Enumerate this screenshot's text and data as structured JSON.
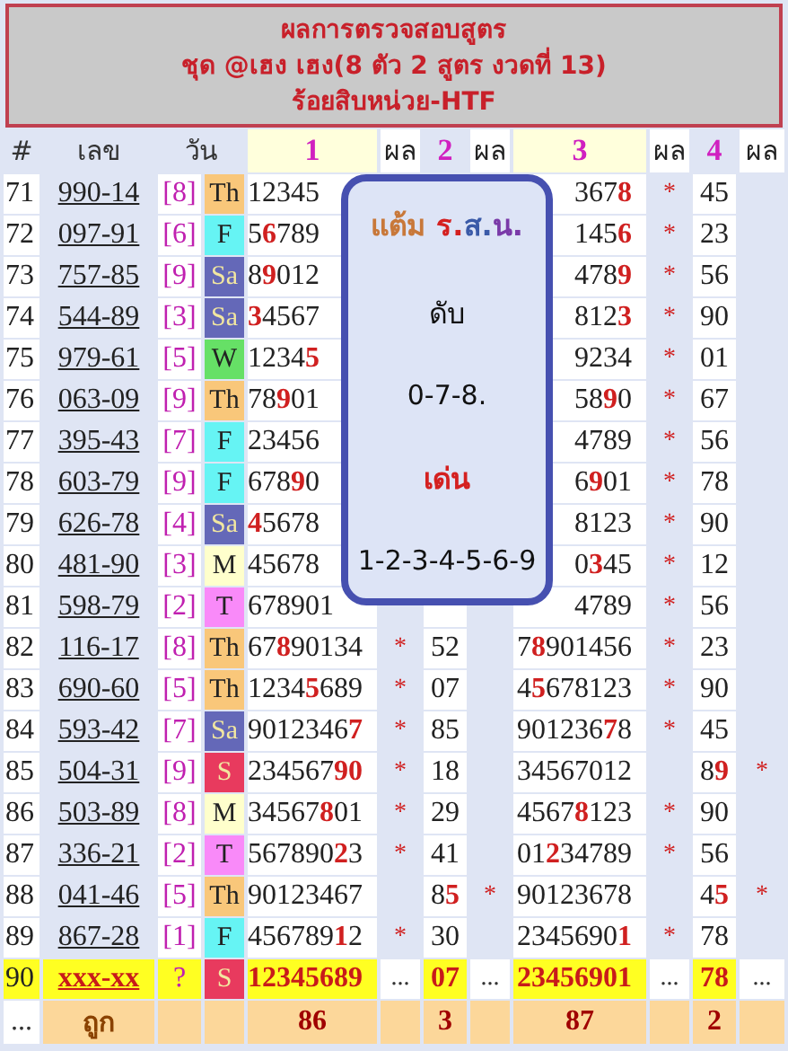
{
  "title": {
    "lines": [
      "ผลการตรวจสอบสูตร",
      "ชุด @เฮง เฮง(8 ตัว 2 สูตร งวดที่ 13)",
      "ร้อยสิบหน่วย-HTF"
    ]
  },
  "header": [
    "#",
    "เลข",
    "วัน",
    "1",
    "ผล",
    "2",
    "ผล",
    "3",
    "ผล",
    "4",
    "ผล"
  ],
  "rows": [
    {
      "no": "71",
      "code": "990-14",
      "digit": "[8]",
      "day": "Th",
      "color": "#f9c77a",
      "highlighted": false,
      "r1": "12345",
      "r3": "367**8**",
      "m3": "*",
      "r4": "45"
    },
    {
      "no": "72",
      "code": "097-91",
      "digit": "[6]",
      "day": "F",
      "color": "#66f4f4",
      "highlighted": false,
      "r1": "5**6**789",
      "r3": "145**6**",
      "m3": "*",
      "r4": "23"
    },
    {
      "no": "73",
      "code": "757-85",
      "digit": "[9]",
      "day": "Sa",
      "color": "#6468b8",
      "highlighted": false,
      "r1": "8**9**012",
      "r3": "478**9**",
      "m3": "*",
      "r4": "56"
    },
    {
      "no": "74",
      "code": "544-89",
      "digit": "[3]",
      "day": "Sa",
      "color": "#6468b8",
      "highlighted": false,
      "r1": "**3**4567",
      "r3": "812**3**",
      "m3": "*",
      "r4": "90"
    },
    {
      "no": "75",
      "code": "979-61",
      "digit": "[5]",
      "day": "W",
      "color": "#66e066",
      "highlighted": false,
      "r1": "1234**5**",
      "r3": "9234",
      "m3": "*",
      "r4": "01"
    },
    {
      "no": "76",
      "code": "063-09",
      "digit": "[9]",
      "day": "Th",
      "color": "#f9c77a",
      "highlighted": false,
      "r1": "78**9**01",
      "r3": "58**9**0",
      "m3": "*",
      "r4": "67"
    },
    {
      "no": "77",
      "code": "395-43",
      "digit": "[7]",
      "day": "F",
      "color": "#66f4f4",
      "highlighted": false,
      "r1": "23456",
      "r3": "4789",
      "m3": "*",
      "r4": "56"
    },
    {
      "no": "78",
      "code": "603-79",
      "digit": "[9]",
      "day": "F",
      "color": "#66f4f4",
      "highlighted": false,
      "r1": "678**9**0",
      "r3": "6**9**01",
      "m3": "*",
      "r4": "78"
    },
    {
      "no": "79",
      "code": "626-78",
      "digit": "[4]",
      "day": "Sa",
      "color": "#6468b8",
      "highlighted": false,
      "r1": "**4**5678",
      "r3": "8123",
      "m3": "*",
      "r4": "90"
    },
    {
      "no": "80",
      "code": "481-90",
      "digit": "[3]",
      "day": "M",
      "color": "#ffffcc",
      "highlighted": false,
      "r1": "45678",
      "r3": "0**3**45",
      "m3": "*",
      "r4": "12"
    },
    {
      "no": "81",
      "code": "598-79",
      "digit": "[2]",
      "day": "T",
      "color": "#f98af9",
      "highlighted": false,
      "r1": "678901",
      "r3": "4789",
      "m3": "*",
      "r4": "56"
    },
    {
      "no": "82",
      "code": "116-17",
      "digit": "[8]",
      "day": "Th",
      "color": "#f9c77a",
      "highlighted": false,
      "r1": "67**8**90134",
      "m1": "*",
      "r2": "52",
      "r3": "7**8**901456",
      "m3": "*",
      "r4": "23"
    },
    {
      "no": "83",
      "code": "690-60",
      "digit": "[5]",
      "day": "Th",
      "color": "#f9c77a",
      "highlighted": false,
      "r1": "1234**5**689",
      "m1": "*",
      "r2": "07",
      "r3": "4**5**678123",
      "m3": "*",
      "r4": "90"
    },
    {
      "no": "84",
      "code": "593-42",
      "digit": "[7]",
      "day": "Sa",
      "color": "#6468b8",
      "highlighted": false,
      "r1": "9012346**7**",
      "m1": "*",
      "r2": "85",
      "r3": "901236**7**8",
      "m3": "*",
      "r4": "45"
    },
    {
      "no": "85",
      "code": "504-31",
      "digit": "[9]",
      "day": "S",
      "color": "#e83a5e",
      "highlighted": false,
      "r1": "234567**90**",
      "m1": "*",
      "r2": "18",
      "r3": "34567012",
      "r4": "8**9**",
      "m4": "*"
    },
    {
      "no": "86",
      "code": "503-89",
      "digit": "[8]",
      "day": "M",
      "color": "#ffffcc",
      "highlighted": false,
      "r1": "34567**8**01",
      "m1": "*",
      "r2": "29",
      "r3": "4567**8**123",
      "m3": "*",
      "r4": "90"
    },
    {
      "no": "87",
      "code": "336-21",
      "digit": "[2]",
      "day": "T",
      "color": "#f98af9",
      "highlighted": false,
      "r1": "567890**2**3",
      "m1": "*",
      "r2": "41",
      "r3": "01**2**34789",
      "m3": "*",
      "r4": "56"
    },
    {
      "no": "88",
      "code": "041-46",
      "digit": "[5]",
      "day": "Th",
      "color": "#f9c77a",
      "highlighted": false,
      "r1": "90123467",
      "r2": "8**5**",
      "m2": "*",
      "r3": "90123678",
      "r4": "4**5**",
      "m4": "*"
    },
    {
      "no": "89",
      "code": "867-28",
      "digit": "[1]",
      "day": "F",
      "color": "#66f4f4",
      "highlighted": false,
      "r1": "456789**1**2",
      "m1": "*",
      "r2": "30",
      "r3": "2345690**1**",
      "m3": "*",
      "r4": "78"
    },
    {
      "no": "90",
      "code": "xxx-xx",
      "digit": "?",
      "day": "S",
      "color": "#e83a5e",
      "highlighted": true,
      "r1": "12345689",
      "m1": "...",
      "r2": "07",
      "m2": "...",
      "r3": "23456901",
      "m3": "...",
      "r4": "78",
      "m4": "..."
    }
  ],
  "footer": {
    "mark": "...",
    "label": "ถูก",
    "totals": [
      "86",
      "3",
      "87",
      "2"
    ]
  },
  "box": {
    "lines": [
      {
        "kind": "heading",
        "parts": [
          {
            "text": "แต้ม",
            "color": "#c8783a"
          },
          {
            "text": " ร.",
            "color": "#d42020"
          },
          {
            "text": "ส.",
            "color": "#3a5aa8"
          },
          {
            "text": "น.",
            "color": "#7a3aa8"
          }
        ]
      },
      {
        "kind": "label",
        "text": "ดับ"
      },
      {
        "kind": "value",
        "text": "0-7-8."
      },
      {
        "kind": "highlight",
        "text": "เด่น"
      },
      {
        "kind": "value",
        "text": "1-2-3-4-5-6-9"
      }
    ]
  }
}
